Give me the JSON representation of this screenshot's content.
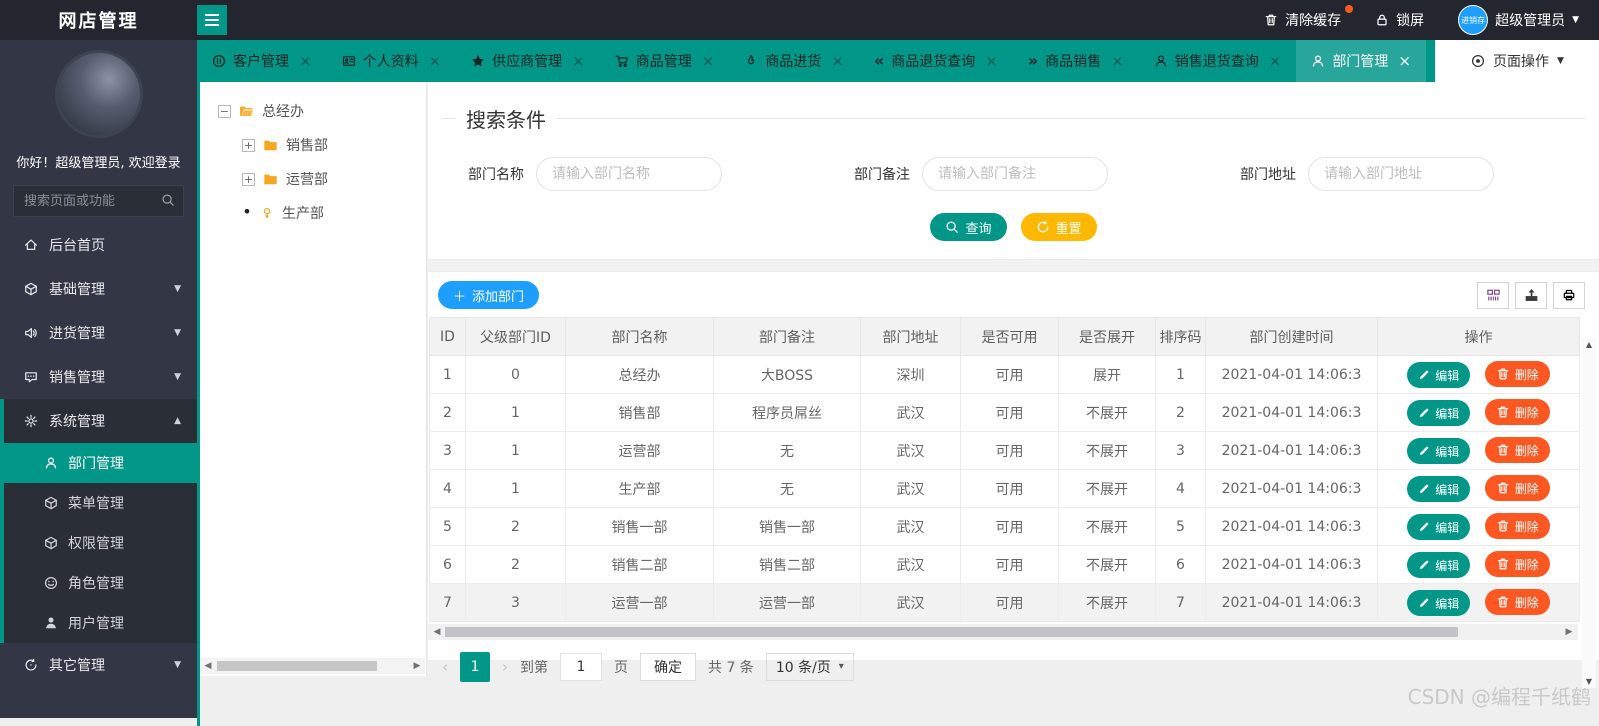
{
  "colors": {
    "accent": "#009688",
    "blue": "#1E9FFF",
    "yellow": "#FFB800",
    "orange": "#FF5722",
    "status_blue": "#1414F0",
    "status_red": "#FF0000",
    "topbar": "#23262E",
    "sidebar": "#333745"
  },
  "header": {
    "title": "网店管理",
    "clear_cache": "清除缓存",
    "lock_screen": "锁屏",
    "avatar_text": "进销存",
    "username": "超级管理员"
  },
  "tabs": [
    {
      "icon": "pause-circle-icon",
      "label": "客户管理",
      "active": false
    },
    {
      "icon": "id-card-icon",
      "label": "个人资料",
      "active": false
    },
    {
      "icon": "star-icon",
      "label": "供应商管理",
      "active": false
    },
    {
      "icon": "cart-icon",
      "label": "商品管理",
      "active": false
    },
    {
      "icon": "fire-icon",
      "label": "商品进货",
      "active": false
    },
    {
      "icon": "angles-left-icon",
      "label": "商品退货查询",
      "active": false
    },
    {
      "icon": "angles-right-icon",
      "label": "商品销售",
      "active": false
    },
    {
      "icon": "person-icon",
      "label": "销售退货查询",
      "active": false
    },
    {
      "icon": "person-icon",
      "label": "部门管理",
      "active": true
    }
  ],
  "page_ops": {
    "icon": "dot-circle-icon",
    "label": "页面操作"
  },
  "sidebar": {
    "welcome": "你好！超级管理员, 欢迎登录",
    "search_placeholder": "搜索页面或功能",
    "items": [
      {
        "icon": "home-icon",
        "label": "后台首页"
      },
      {
        "icon": "cube-icon",
        "label": "基础管理",
        "caret": "down"
      },
      {
        "icon": "volume-icon",
        "label": "进货管理",
        "caret": "down"
      },
      {
        "icon": "comment-icon",
        "label": "销售管理",
        "caret": "down"
      },
      {
        "icon": "gear-icon",
        "label": "系统管理",
        "caret": "up",
        "open": true,
        "children": [
          {
            "icon": "person-icon",
            "label": "部门管理",
            "active": true
          },
          {
            "icon": "cube-icon",
            "label": "菜单管理"
          },
          {
            "icon": "cube-icon",
            "label": "权限管理"
          },
          {
            "icon": "smiley-icon",
            "label": "角色管理"
          },
          {
            "icon": "user-icon",
            "label": "用户管理"
          }
        ]
      },
      {
        "icon": "cycle-icon",
        "label": "其它管理",
        "caret": "down"
      }
    ]
  },
  "tree": {
    "nodes": [
      {
        "expander": "minus",
        "icon": "folder-open-icon",
        "label": "总经办",
        "level": 0
      },
      {
        "expander": "plus",
        "icon": "folder-icon",
        "label": "销售部",
        "level": 1
      },
      {
        "expander": "plus",
        "icon": "folder-icon",
        "label": "运营部",
        "level": 1
      },
      {
        "expander": "dot",
        "icon": "leaf-icon",
        "label": "生产部",
        "level": 1
      }
    ]
  },
  "search_form": {
    "legend": "搜索条件",
    "fields": [
      {
        "label": "部门名称",
        "placeholder": "请输入部门名称"
      },
      {
        "label": "部门备注",
        "placeholder": "请输入部门备注"
      },
      {
        "label": "部门地址",
        "placeholder": "请输入部门地址"
      }
    ],
    "search_label": "查询",
    "reset_label": "重置"
  },
  "table": {
    "add_label": "添加部门",
    "headers": [
      "ID",
      "父级部门ID",
      "部门名称",
      "部门备注",
      "部门地址",
      "是否可用",
      "是否展开",
      "排序码",
      "部门创建时间",
      "操作"
    ],
    "edit_label": "编辑",
    "delete_label": "删除",
    "rows": [
      {
        "id": "1",
        "parent_id": "0",
        "name": "总经办",
        "note": "大BOSS",
        "address": "深圳",
        "enabled": "可用",
        "expand": "展开",
        "sort": "1",
        "created": "2021-04-01 14:06:3",
        "striped": false
      },
      {
        "id": "2",
        "parent_id": "1",
        "name": "销售部",
        "note": "程序员屌丝",
        "address": "武汉",
        "enabled": "可用",
        "expand": "不展开",
        "sort": "2",
        "created": "2021-04-01 14:06:3",
        "striped": false
      },
      {
        "id": "3",
        "parent_id": "1",
        "name": "运营部",
        "note": "无",
        "address": "武汉",
        "enabled": "可用",
        "expand": "不展开",
        "sort": "3",
        "created": "2021-04-01 14:06:3",
        "striped": false
      },
      {
        "id": "4",
        "parent_id": "1",
        "name": "生产部",
        "note": "无",
        "address": "武汉",
        "enabled": "可用",
        "expand": "不展开",
        "sort": "4",
        "created": "2021-04-01 14:06:3",
        "striped": false
      },
      {
        "id": "5",
        "parent_id": "2",
        "name": "销售一部",
        "note": "销售一部",
        "address": "武汉",
        "enabled": "可用",
        "expand": "不展开",
        "sort": "5",
        "created": "2021-04-01 14:06:3",
        "striped": false
      },
      {
        "id": "6",
        "parent_id": "2",
        "name": "销售二部",
        "note": "销售二部",
        "address": "武汉",
        "enabled": "可用",
        "expand": "不展开",
        "sort": "6",
        "created": "2021-04-01 14:06:3",
        "striped": false
      },
      {
        "id": "7",
        "parent_id": "3",
        "name": "运营一部",
        "note": "运营一部",
        "address": "武汉",
        "enabled": "可用",
        "expand": "不展开",
        "sort": "7",
        "created": "2021-04-01 14:06:3",
        "striped": true
      }
    ]
  },
  "pagination": {
    "current_page": "1",
    "goto_label": "到第",
    "goto_value": "1",
    "page_unit": "页",
    "confirm_label": "确定",
    "total_label": "共 7 条",
    "page_size": "10 条/页"
  },
  "watermark": "CSDN @编程千纸鹤"
}
